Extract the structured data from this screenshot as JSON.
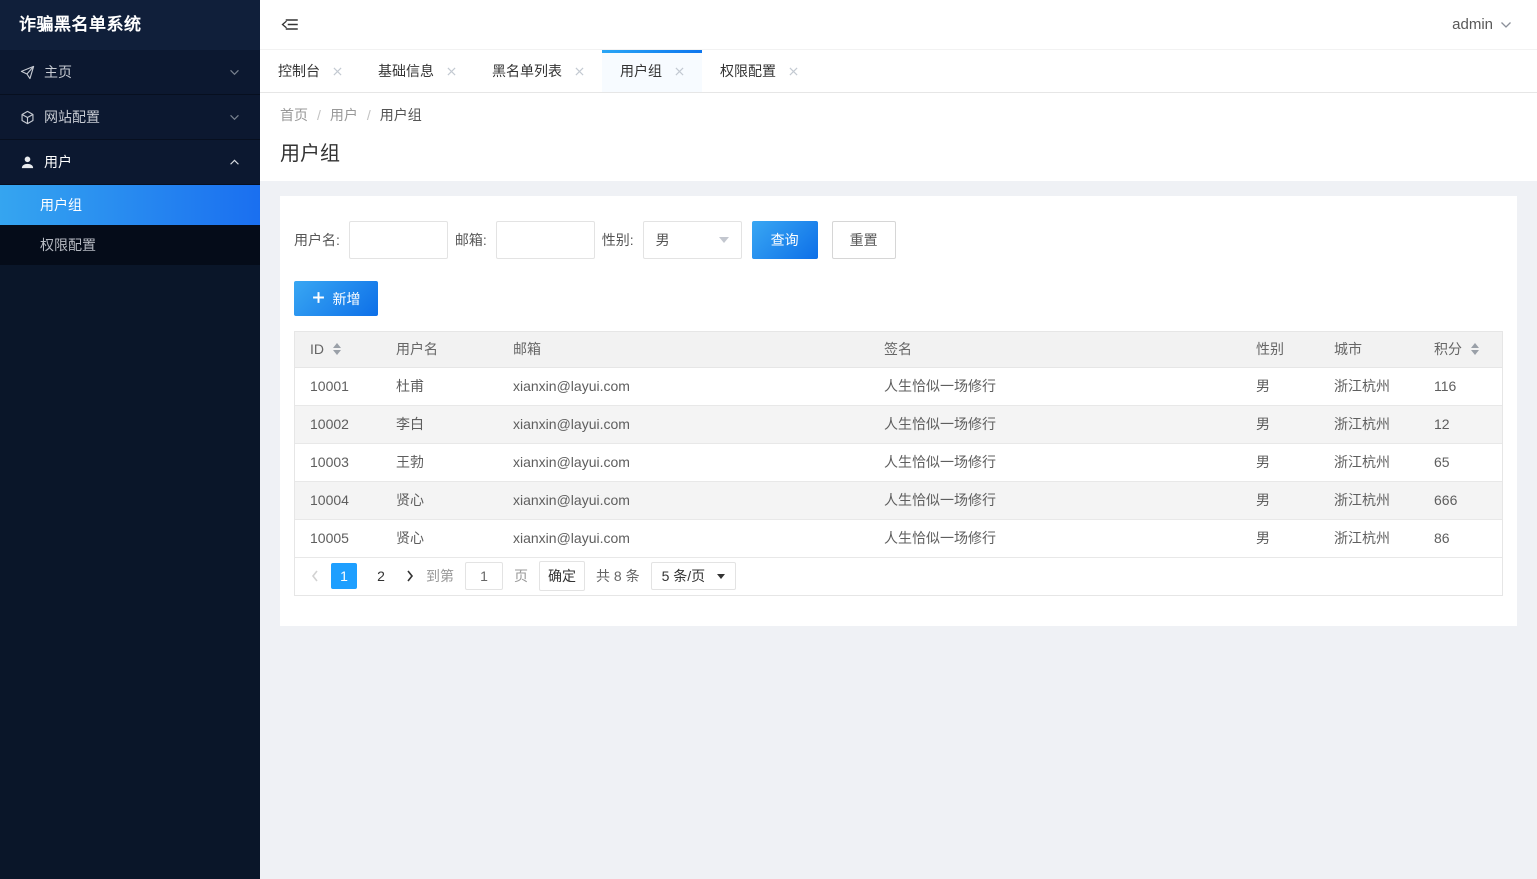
{
  "app": {
    "sidebar_title": "诈骗黑名单系统"
  },
  "topbar": {
    "user": "admin"
  },
  "icons": {
    "collapse": "collapse-sidebar-icon",
    "home": "send-icon",
    "site": "component-icon",
    "user": "user-icon",
    "expand_state": "chevron-icons",
    "tab_close": "close-icon",
    "add": "plus-icon",
    "sort": "sort-caret-icon"
  },
  "colors": {
    "accent": "#1e9fff",
    "accent_gradient_start": "#39a7f3",
    "accent_gradient_end": "#0d6fe8",
    "sidebar_bg": "#0a1629",
    "sidebar_active_gradient": "linear-gradient(90deg,#35a5f0,#1a6ff0)",
    "content_bg": "#eff1f5"
  },
  "sidebar": {
    "items": [
      {
        "label": "主页",
        "icon": "send-icon",
        "state": "collapsed"
      },
      {
        "label": "网站配置",
        "icon": "component-icon",
        "state": "collapsed"
      },
      {
        "label": "用户",
        "icon": "user-icon",
        "state": "expanded",
        "children": [
          {
            "label": "用户组",
            "active": true
          },
          {
            "label": "权限配置",
            "active": false
          }
        ]
      }
    ]
  },
  "tabs": [
    {
      "label": "控制台",
      "active": false
    },
    {
      "label": "基础信息",
      "active": false
    },
    {
      "label": "黑名单列表",
      "active": false
    },
    {
      "label": "用户组",
      "active": true
    },
    {
      "label": "权限配置",
      "active": false
    }
  ],
  "breadcrumb": {
    "items": [
      "首页",
      "用户",
      "用户组"
    ],
    "separator": "/"
  },
  "page": {
    "title": "用户组"
  },
  "filters": {
    "username_label": "用户名:",
    "username_value": "",
    "email_label": "邮箱:",
    "email_value": "",
    "gender_label": "性别:",
    "gender_value": "男",
    "search_button": "查询",
    "reset_button": "重置"
  },
  "toolbar": {
    "add_button": "新增"
  },
  "table": {
    "columns": [
      "ID",
      "用户名",
      "邮箱",
      "签名",
      "性别",
      "城市",
      "积分"
    ],
    "sortable_columns": [
      "ID",
      "积分"
    ],
    "rows": [
      [
        "10001",
        "杜甫",
        "xianxin@layui.com",
        "人生恰似一场修行",
        "男",
        "浙江杭州",
        "116"
      ],
      [
        "10002",
        "李白",
        "xianxin@layui.com",
        "人生恰似一场修行",
        "男",
        "浙江杭州",
        "12"
      ],
      [
        "10003",
        "王勃",
        "xianxin@layui.com",
        "人生恰似一场修行",
        "男",
        "浙江杭州",
        "65"
      ],
      [
        "10004",
        "贤心",
        "xianxin@layui.com",
        "人生恰似一场修行",
        "男",
        "浙江杭州",
        "666"
      ],
      [
        "10005",
        "贤心",
        "xianxin@layui.com",
        "人生恰似一场修行",
        "男",
        "浙江杭州",
        "86"
      ]
    ]
  },
  "pagination": {
    "pages": [
      "1",
      "2"
    ],
    "current": "1",
    "goto_label": "到第",
    "goto_value": "1",
    "unit_label": "页",
    "confirm_button": "确定",
    "total_label": "共 8 条",
    "page_size_value": "5 条/页"
  }
}
